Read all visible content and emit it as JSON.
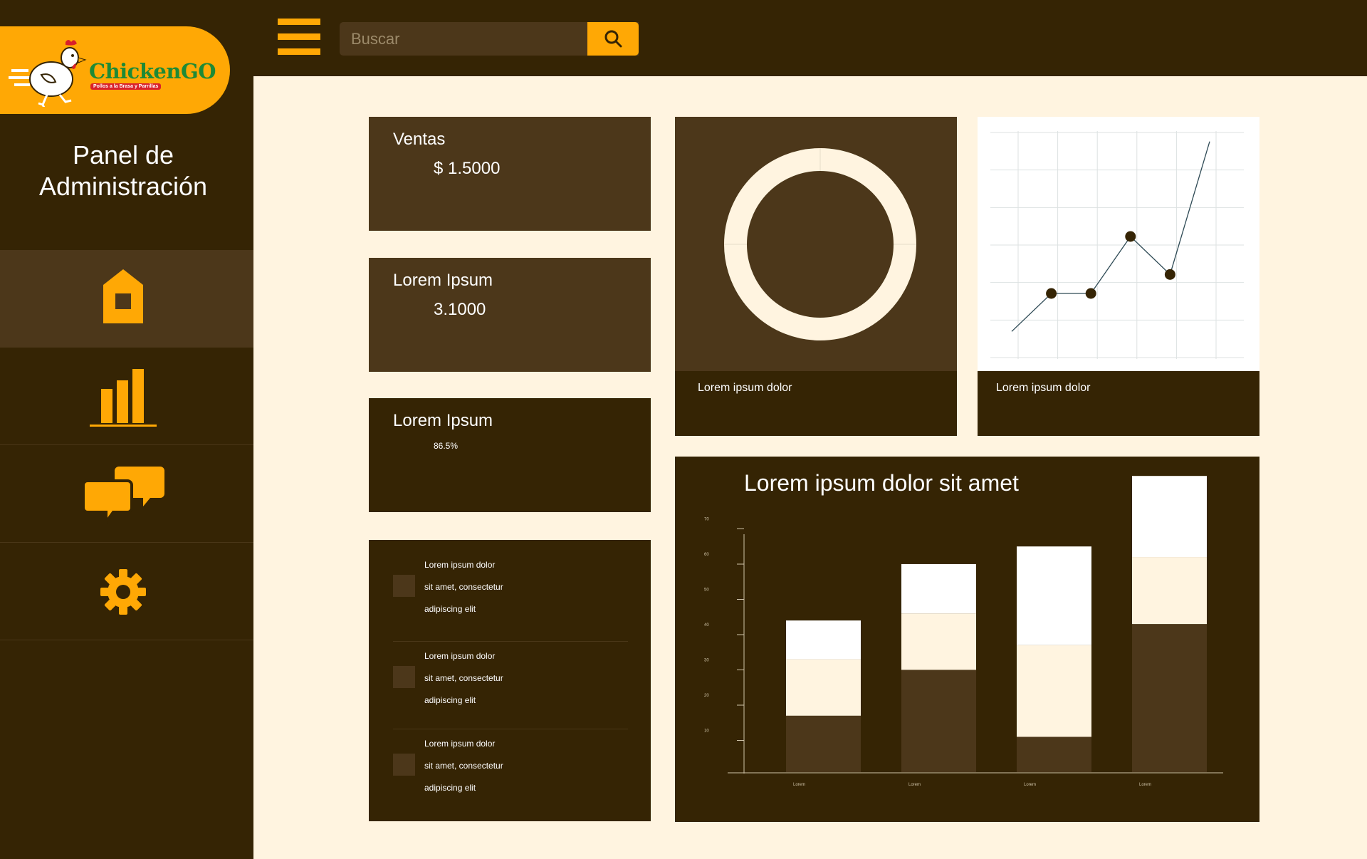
{
  "brand": {
    "name": "ChickenGO",
    "tagline": "Pollos a la Brasa y Parrillas"
  },
  "sidebar": {
    "title_line1": "Panel de",
    "title_line2": "Administración",
    "items": [
      {
        "name": "home",
        "icon": "home-icon",
        "active": true
      },
      {
        "name": "stats",
        "icon": "bar-chart-icon",
        "active": false
      },
      {
        "name": "messages",
        "icon": "chat-icon",
        "active": false
      },
      {
        "name": "settings",
        "icon": "gear-icon",
        "active": false
      }
    ]
  },
  "search": {
    "placeholder": "Buscar"
  },
  "stats": [
    {
      "label": "Ventas",
      "value": "$ 1.5000"
    },
    {
      "label": "Lorem Ipsum",
      "value": "3.1000"
    },
    {
      "label": "Lorem Ipsum",
      "value": "86.5%"
    }
  ],
  "list": [
    {
      "line1": "Lorem ipsum dolor",
      "line2": "sit amet, consectetur",
      "line3": "adipiscing elit"
    },
    {
      "line1": "Lorem ipsum dolor",
      "line2": "sit amet, consectetur",
      "line3": "adipiscing elit"
    },
    {
      "line1": "Lorem ipsum dolor",
      "line2": "sit amet, consectetur",
      "line3": "adipiscing elit"
    }
  ],
  "donut_caption": "Lorem ipsum dolor",
  "line_caption": "Lorem ipsum dolor",
  "colors": {
    "dark": "#352404",
    "brown": "#4C371A",
    "accent": "#FFA805",
    "cream": "#FFF4E0"
  },
  "chart_data": [
    {
      "type": "pie",
      "values": [
        100
      ],
      "title": ""
    },
    {
      "type": "line",
      "x": [
        0,
        1,
        2,
        3,
        4,
        5
      ],
      "y": [
        0.5,
        1.5,
        1.5,
        3.0,
        2.0,
        5.5
      ],
      "ylim": [
        0,
        6
      ],
      "grid": true,
      "markers_on": [
        1,
        2,
        3,
        4
      ]
    },
    {
      "type": "bar",
      "stacked": true,
      "title": "Lorem ipsum dolor sit amet",
      "categories": [
        "Lorem",
        "Lorem",
        "Lorem",
        "Lorem"
      ],
      "yticks": [
        10,
        20,
        30,
        40,
        50,
        60,
        70
      ],
      "ylim": [
        0,
        80
      ],
      "series": [
        {
          "values": [
            16,
            29,
            10,
            42
          ]
        },
        {
          "values": [
            16,
            16,
            26,
            19
          ]
        },
        {
          "values": [
            11,
            14,
            28,
            23
          ]
        }
      ],
      "series_colors": [
        "#4C371A",
        "#FFF4E0",
        "#FFFFFF"
      ]
    }
  ]
}
